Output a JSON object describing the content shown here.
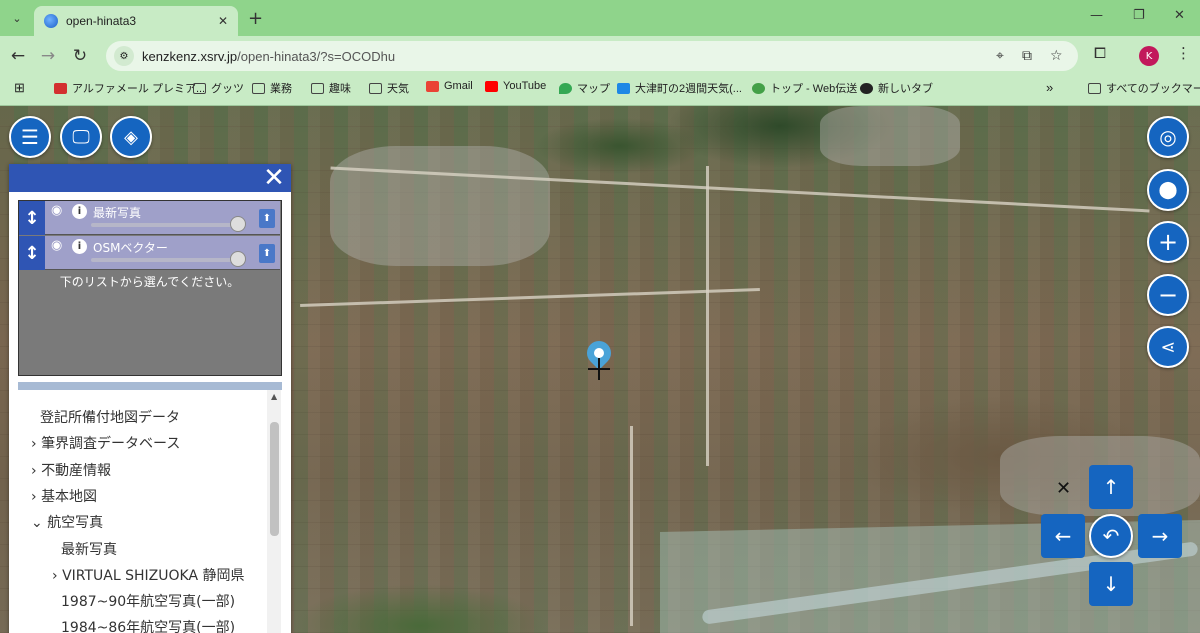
{
  "browser": {
    "tab_title": "open-hinata3",
    "url_host": "kenzkenz.xsrv.jp",
    "url_path": "/open-hinata3/?s=OCODhu",
    "bookmarks": [
      {
        "label": "アルファメール プレミア...",
        "icon": "alpha-mail-icon",
        "color": "#d32f2f"
      },
      {
        "label": "グッツ",
        "icon": "folder-icon"
      },
      {
        "label": "業務",
        "icon": "folder-icon"
      },
      {
        "label": "趣味",
        "icon": "folder-icon"
      },
      {
        "label": "天気",
        "icon": "folder-icon"
      },
      {
        "label": "Gmail",
        "icon": "gmail-icon",
        "color": "#ea4335"
      },
      {
        "label": "YouTube",
        "icon": "youtube-icon",
        "color": "#ff0000"
      },
      {
        "label": "マップ",
        "icon": "maps-icon",
        "color": "#34a853"
      },
      {
        "label": "大津町の2週間天気(...",
        "icon": "weather-icon",
        "color": "#1e88e5"
      },
      {
        "label": "トップ - Web伝送",
        "icon": "web-icon",
        "color": "#43a047"
      },
      {
        "label": "新しいタブ",
        "icon": "globe-icon",
        "color": "#222222"
      }
    ],
    "all_bookmarks_label": "すべてのブックマーク",
    "avatar_letter": "K"
  },
  "panel": {
    "layers": [
      {
        "name": "最新写真",
        "opacity_percent": 100
      },
      {
        "name": "OSMベクター",
        "opacity_percent": 100
      }
    ],
    "hint": "下のリストから選んでください。",
    "tree": [
      {
        "label": "登記所備付地図データ",
        "indent": 0,
        "arrow": ""
      },
      {
        "label": "筆界調査データベース",
        "indent": 0,
        "arrow": "›"
      },
      {
        "label": "不動産情報",
        "indent": 0,
        "arrow": "›"
      },
      {
        "label": "基本地図",
        "indent": 0,
        "arrow": "›"
      },
      {
        "label": "航空写真",
        "indent": 0,
        "arrow": "⌄"
      },
      {
        "label": "最新写真",
        "indent": 1,
        "arrow": ""
      },
      {
        "label": "VIRTUAL SHIZUOKA 静岡県",
        "indent": 1,
        "arrow": "›"
      },
      {
        "label": "1987~90年航空写真(一部)",
        "indent": 1,
        "arrow": ""
      },
      {
        "label": "1984~86年航空写真(一部)",
        "indent": 1,
        "arrow": ""
      }
    ]
  },
  "colors": {
    "accent": "#1565c0",
    "panel_header": "#2f55b4",
    "chrome_green": "#8fd48b"
  }
}
